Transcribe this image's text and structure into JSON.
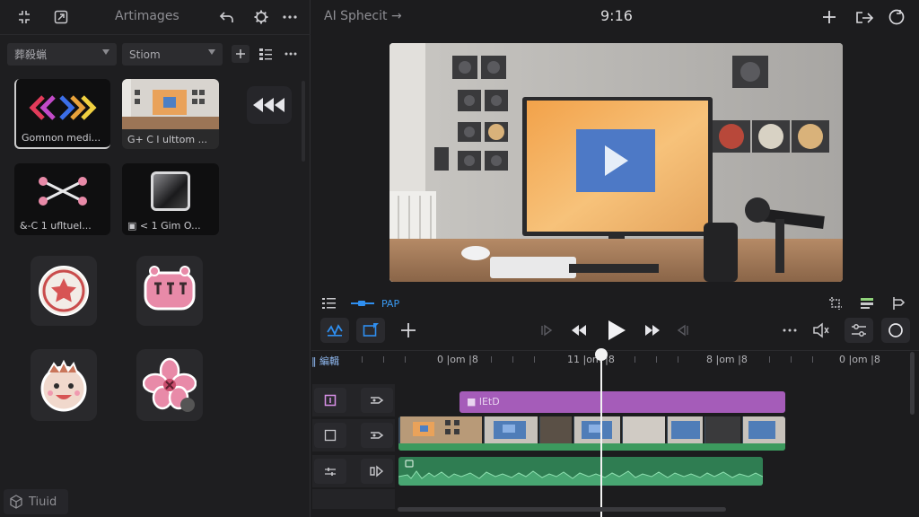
{
  "left_panel": {
    "title": "Artimages",
    "filter_primary": "葬殺蝋",
    "filter_secondary": "Stiom",
    "tiles": [
      {
        "caption": "Gomnon medi..."
      },
      {
        "caption": "G+ C l ulttom ..."
      },
      {
        "caption": "&-C 1 ufltuel..."
      },
      {
        "caption": "▣ < 1 Gim O..."
      }
    ],
    "bottom_label": "Tiuid"
  },
  "topbar": {
    "title": "AI Sphecit",
    "time": "9:16"
  },
  "timeline": {
    "label": "PAP",
    "ruler_first": "‖ 編輯",
    "ruler_labels": [
      "0 |om |8",
      "11 |om |8",
      "8 |om |8",
      "0 |om |8"
    ],
    "purple_clip_label": "■ lEtD"
  },
  "colors": {
    "accent_blue": "#2f8ff0",
    "purple_clip": "#a55cb9",
    "green_clip": "#2f7a4f"
  }
}
